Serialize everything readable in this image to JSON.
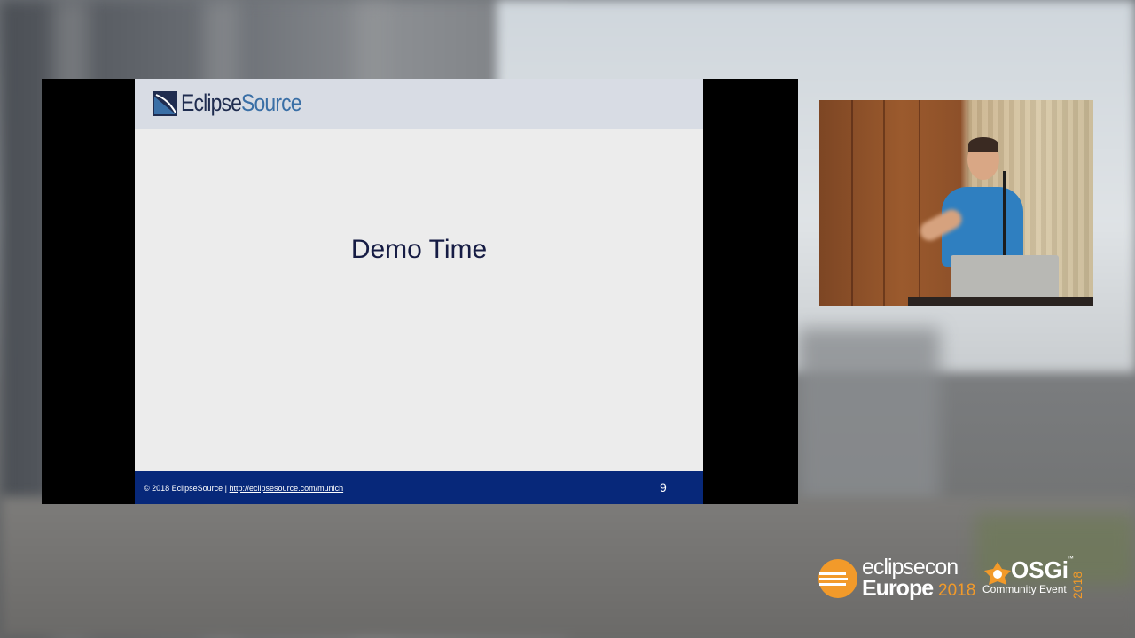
{
  "slide": {
    "logo": {
      "part1": "Eclipse",
      "part2": "Source"
    },
    "title": "Demo Time",
    "footer": {
      "copyright": "© 2018 EclipseSource | ",
      "link": "http://eclipsesource.com/munich"
    },
    "page_number": "9"
  },
  "event_branding": {
    "eclipsecon_line1": "eclipsecon",
    "eclipsecon_line2": "Europe",
    "eclipsecon_year": "2018",
    "osgi_title": "OSGi",
    "osgi_tm": "™",
    "osgi_subtitle": "Community Event",
    "osgi_year": "2018"
  },
  "colors": {
    "slide_footer": "#07287a",
    "slide_header": "#d8dce4",
    "accent_orange": "#f29a2a",
    "logo_blue": "#3a6fa6"
  }
}
